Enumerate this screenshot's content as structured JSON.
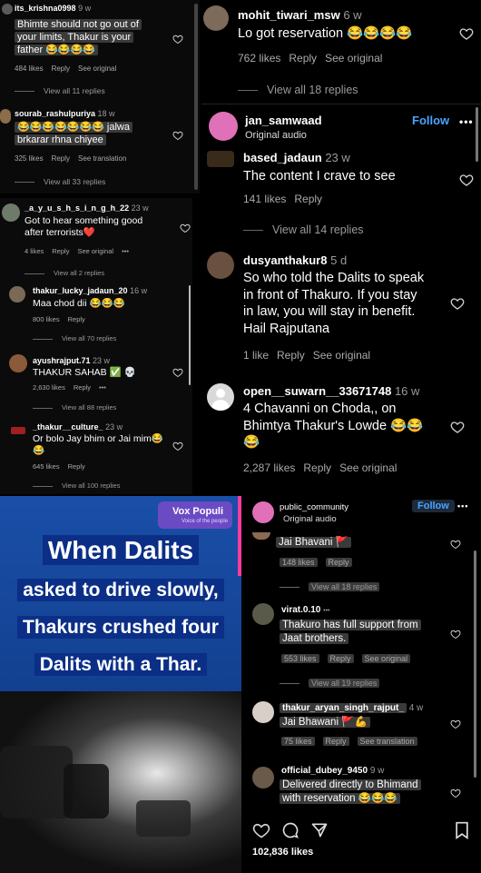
{
  "panel_a": {
    "comments": [
      {
        "user": "its_krishna0998",
        "time": "9 w",
        "text": [
          "Bhimte should not go out of",
          "your limits, Thakur is your",
          "father 😂😂😂😂"
        ],
        "likes": "484 likes",
        "reply": "Reply",
        "action": "See original",
        "view_all": "View all 11 replies"
      },
      {
        "user": "sourab_rashulpuriya",
        "time": "18 w",
        "text": [
          "😂😂😂😂😂😂😂 jalwa",
          "brkarar rhna chiyee"
        ],
        "likes": "325 likes",
        "reply": "Reply",
        "action": "See translation",
        "view_all": "View all 33 replies"
      }
    ]
  },
  "panel_b": {
    "comments": [
      {
        "user": "_a_y_u_s_h_s_i_n_g_h_22",
        "time": "23 w",
        "text": [
          "Got to hear something good",
          "after terrorists❤️"
        ],
        "likes": "4 likes",
        "reply": "Reply",
        "action": "See original",
        "extra": "•••",
        "view_all": "View all 2 replies"
      },
      {
        "user": "thakur_lucky_jadaun_20",
        "time": "16 w",
        "text": [
          "Maa chod dii 😂😂😂"
        ],
        "likes": "800 likes",
        "reply": "Reply",
        "view_all": "View all 70 replies"
      },
      {
        "user": "ayushrajput.71",
        "time": "23 w",
        "text": [
          "THAKUR SAHAB ✅ 💀"
        ],
        "likes": "2,630 likes",
        "reply": "Reply",
        "extra": "•••",
        "view_all": "View all 88 replies"
      },
      {
        "user": "_thakur__culture_",
        "time": "23 w",
        "text": [
          "Or bolo Jay bhim or Jai mim😂",
          "😂"
        ],
        "likes": "645 likes",
        "reply": "Reply",
        "view_all": "View all 100 replies"
      }
    ]
  },
  "panel_c": {
    "top": {
      "user": "mohit_tiwari_msw",
      "time": "6 w",
      "text": [
        "Lo got reservation 😂😂😂😂"
      ],
      "likes": "762 likes",
      "reply": "Reply",
      "action": "See original",
      "view_all": "View all 18 replies"
    },
    "post": {
      "account": "jan_samwaad",
      "audio": "Original audio",
      "follow": "Follow",
      "more": "•••"
    },
    "comments": [
      {
        "user": "based_jadaun",
        "time": "23 w",
        "text": [
          "The content I crave to see"
        ],
        "likes": "141 likes",
        "reply": "Reply",
        "view_all": "View all 14 replies"
      },
      {
        "user": "dusyanthakur8",
        "time": "5 d",
        "text": [
          "So who told the Dalits to speak",
          "in front of Thakuro. If you stay",
          "in law, you will stay in benefit.",
          "Hail Rajputana"
        ],
        "likes": "1 like",
        "reply": "Reply",
        "action": "See original"
      },
      {
        "user": "open__suwarn__33671748",
        "time": "16 w",
        "text": [
          "4 Chavanni on Choda,, on",
          "Bhimtya Thakur's Lowde 😂😂",
          "😂"
        ],
        "likes": "2,287 likes",
        "reply": "Reply",
        "action": "See original"
      }
    ]
  },
  "panel_d": {
    "badge_title": "Vox Populi",
    "badge_sub": "Voice of the people",
    "lines": [
      "When Dalits",
      "asked to drive slowly,",
      "Thakurs crushed four",
      "Dalits with a Thar."
    ]
  },
  "panel_e": {
    "post": {
      "account": "public_community",
      "audio": "Original audio",
      "follow": "Follow",
      "more": "•••"
    },
    "comments": [
      {
        "user": "",
        "time": "",
        "text": [
          "Jai Bhavani 🚩"
        ],
        "likes": "148 likes",
        "reply": "Reply",
        "view_all": "View all 18 replies"
      },
      {
        "user": "virat.0.10",
        "time": "",
        "text": [
          "Thakuro has full support from",
          "Jaat brothers."
        ],
        "likes": "553 likes",
        "reply": "Reply",
        "action": "See original",
        "view_all": "View all 19 replies"
      },
      {
        "user": "thakur_aryan_singh_rajput_",
        "time": "4 w",
        "text": [
          "Jai Bhawani 🚩💪"
        ],
        "likes": "75 likes",
        "reply": "Reply",
        "action": "See translation"
      },
      {
        "user": "official_dubey_9450",
        "time": "9 w",
        "text": [
          "Delivered directly to Bhimand",
          "with reservation 😂😂😂"
        ]
      }
    ],
    "post_likes": "102,836 likes"
  },
  "colors": {
    "follow": "#4aa3ff",
    "bg": "#000000",
    "news_blue": "#1a4fa8",
    "vox": "#6b4bc4"
  }
}
